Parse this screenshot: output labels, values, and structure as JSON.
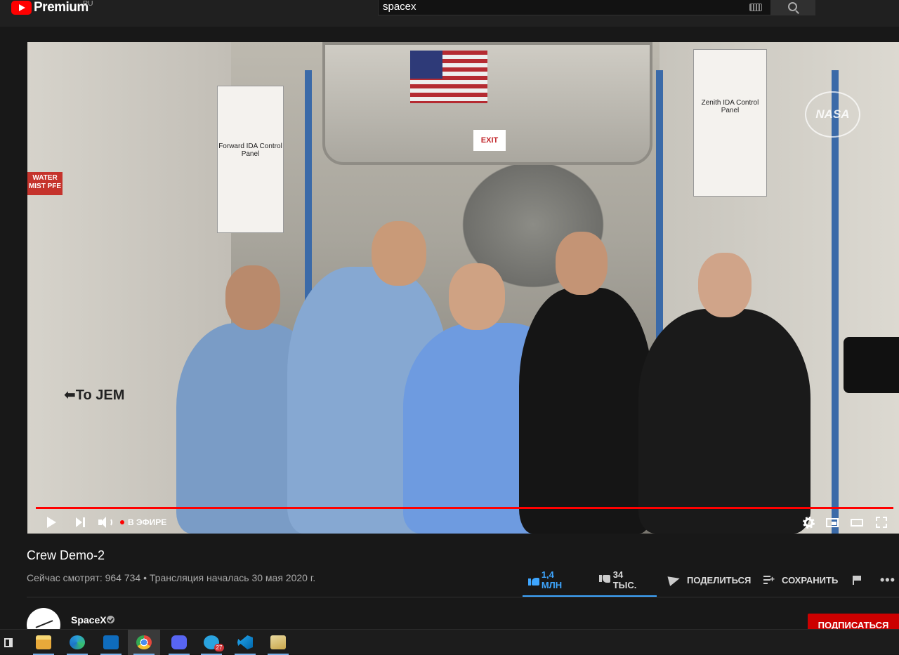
{
  "header": {
    "logo_text": "Premium",
    "country_code": "RU",
    "search_value": "spacex",
    "icons": [
      "youtube-logo-icon",
      "keyboard-icon",
      "search-icon"
    ]
  },
  "player": {
    "live_label": "В ЭФИРЕ",
    "scene_text": {
      "to_jem": "⬅To JEM",
      "exit": "EXIT",
      "forward_panel": "Forward IDA Control Panel",
      "zenith_panel": "Zenith IDA Control Panel",
      "water_sign": "WATER MIST PFE",
      "nasa": "NASA"
    },
    "colors": {
      "progress": "#ff0000",
      "live_dot": "#ff0000"
    }
  },
  "video": {
    "title": "Crew Demo-2",
    "meta": "Сейчас смотрят: 964 734 • Трансляция началась 30 мая 2020 г.",
    "likes": "1,4 МЛН",
    "dislikes": "34 ТЫС.",
    "share_label": "ПОДЕЛИТЬСЯ",
    "save_label": "СОХРАНИТЬ",
    "more_label": "•••",
    "colors": {
      "like_active": "#3ea6ff"
    }
  },
  "channel": {
    "name": "SpaceX",
    "subscribe_label": "ПОДПИСАТЬСЯ"
  },
  "taskbar": {
    "items": [
      {
        "icon": "task-view-icon",
        "color": "#ffffff"
      },
      {
        "icon": "file-explorer-icon",
        "color": "#f2c744"
      },
      {
        "icon": "edge-icon",
        "color": "#2b9fd8"
      },
      {
        "icon": "outlook-icon",
        "color": "#0f6cbd"
      },
      {
        "icon": "chrome-icon",
        "color": "#e6483d"
      },
      {
        "icon": "discord-icon",
        "color": "#5865f2"
      },
      {
        "icon": "telegram-icon",
        "color": "#2aa3df",
        "badge": "27"
      },
      {
        "icon": "vscode-icon",
        "color": "#23a9f2"
      },
      {
        "icon": "app-icon",
        "color": "#c9a64a"
      }
    ]
  }
}
